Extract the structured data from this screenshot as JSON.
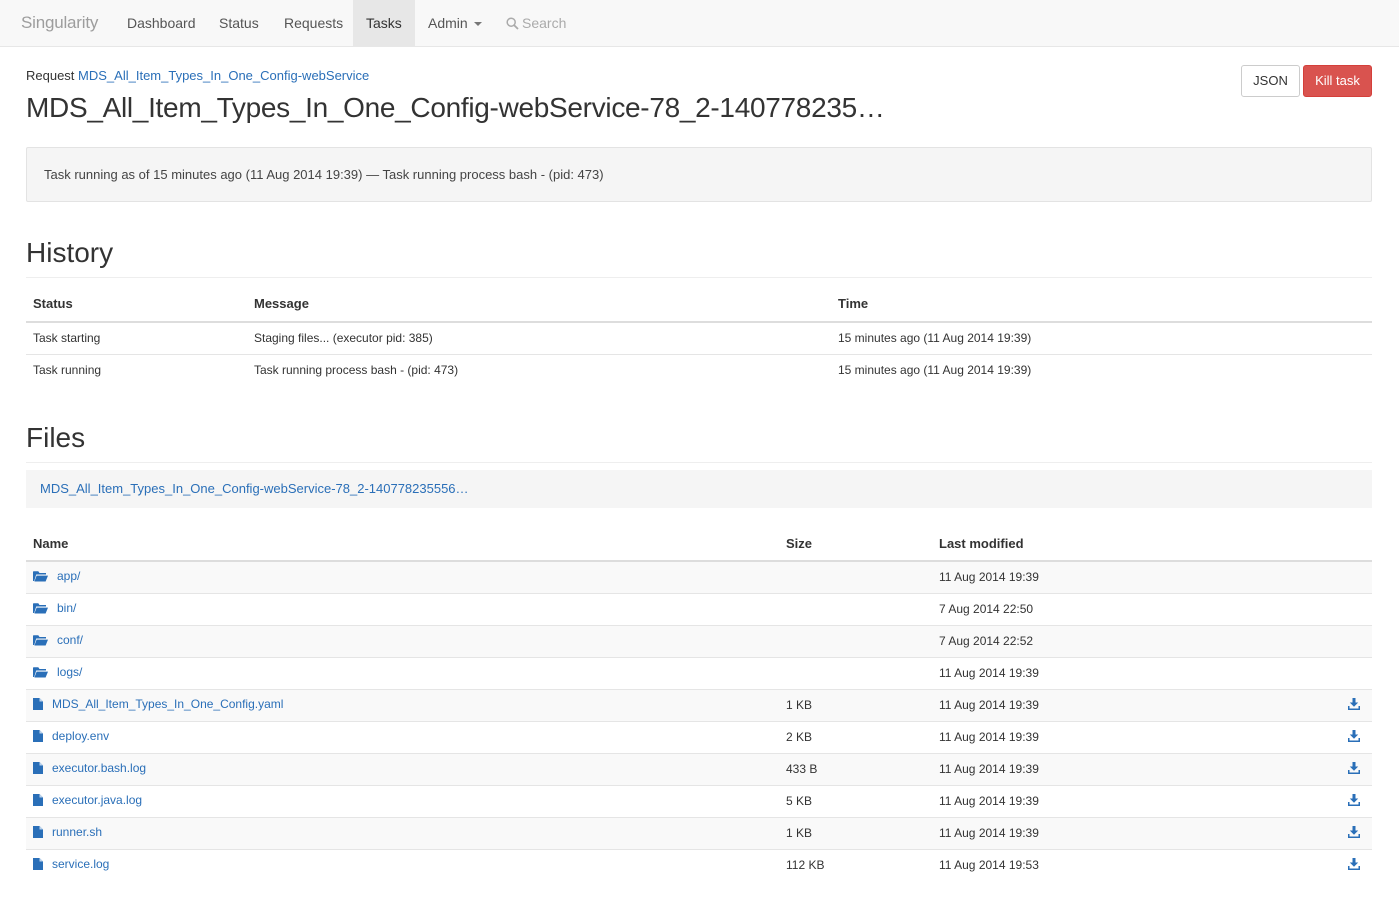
{
  "navbar": {
    "brand": "Singularity",
    "items": [
      {
        "label": "Dashboard",
        "active": false
      },
      {
        "label": "Status",
        "active": false
      },
      {
        "label": "Requests",
        "active": false
      },
      {
        "label": "Tasks",
        "active": true
      },
      {
        "label": "Admin",
        "active": false,
        "dropdown": true
      }
    ],
    "search_label": "Search"
  },
  "header": {
    "request_prefix": "Request",
    "request_link": "MDS_All_Item_Types_In_One_Config-webService",
    "task_title": "MDS_All_Item_Types_In_One_Config-webService-78_2-140778235…",
    "json_button": "JSON",
    "kill_button": "Kill task"
  },
  "status_well": "Task running as of 15 minutes ago (11 Aug 2014 19:39) — Task running process bash - (pid: 473)",
  "history": {
    "heading": "History",
    "columns": [
      "Status",
      "Message",
      "Time"
    ],
    "rows": [
      {
        "status": "Task starting",
        "message": "Staging files... (executor pid: 385)",
        "time": "15 minutes ago (11 Aug 2014 19:39)"
      },
      {
        "status": "Task running",
        "message": "Task running process bash - (pid: 473)",
        "time": "15 minutes ago (11 Aug 2014 19:39)"
      }
    ]
  },
  "files": {
    "heading": "Files",
    "path": "MDS_All_Item_Types_In_One_Config-webService-78_2-140778235556…",
    "columns": [
      "Name",
      "Size",
      "Last modified"
    ],
    "rows": [
      {
        "name": "app/",
        "type": "folder",
        "size": "",
        "modified": "11 Aug 2014 19:39"
      },
      {
        "name": "bin/",
        "type": "folder",
        "size": "",
        "modified": "7 Aug 2014 22:50"
      },
      {
        "name": "conf/",
        "type": "folder",
        "size": "",
        "modified": "7 Aug 2014 22:52"
      },
      {
        "name": "logs/",
        "type": "folder",
        "size": "",
        "modified": "11 Aug 2014 19:39"
      },
      {
        "name": "MDS_All_Item_Types_In_One_Config.yaml",
        "type": "file",
        "size": "1 KB",
        "modified": "11 Aug 2014 19:39"
      },
      {
        "name": "deploy.env",
        "type": "file",
        "size": "2 KB",
        "modified": "11 Aug 2014 19:39"
      },
      {
        "name": "executor.bash.log",
        "type": "file",
        "size": "433 B",
        "modified": "11 Aug 2014 19:39"
      },
      {
        "name": "executor.java.log",
        "type": "file",
        "size": "5 KB",
        "modified": "11 Aug 2014 19:39"
      },
      {
        "name": "runner.sh",
        "type": "file",
        "size": "1 KB",
        "modified": "11 Aug 2014 19:39"
      },
      {
        "name": "service.log",
        "type": "file",
        "size": "112 KB",
        "modified": "11 Aug 2014 19:53"
      }
    ]
  },
  "colors": {
    "link": "#2a6fb8",
    "danger": "#d9534f",
    "navbar_bg": "#f8f8f8"
  }
}
